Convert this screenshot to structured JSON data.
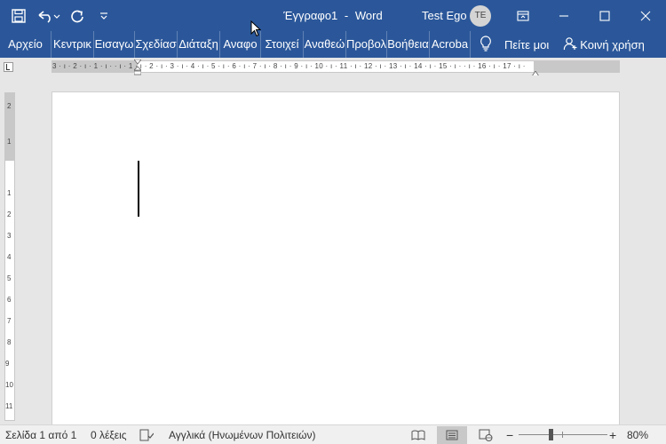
{
  "colors": {
    "accent": "#2b579a",
    "statusbar": "#f0f0f0",
    "canvas": "#e6e6e6"
  },
  "qat": {
    "save_icon": "save-icon",
    "undo_icon": "undo-icon",
    "redo_icon": "redo-icon",
    "customize_icon": "customize-qat-icon"
  },
  "window": {
    "doc_title": "Έγγραφο1",
    "separator": "-",
    "app_name": "Word",
    "user_name": "Test Ego",
    "user_initials": "TE"
  },
  "tabs": [
    {
      "label": "Αρχείο"
    },
    {
      "label": "Κεντρικ"
    },
    {
      "label": "Εισαγω"
    },
    {
      "label": "Σχεδίασ"
    },
    {
      "label": "Διάταξη"
    },
    {
      "label": "Αναφο"
    },
    {
      "label": "Στοιχεί"
    },
    {
      "label": "Αναθεώ"
    },
    {
      "label": "Προβολ"
    },
    {
      "label": "Βοήθεια"
    },
    {
      "label": "Acroba"
    }
  ],
  "tell_me": {
    "label": "Πείτε μοι",
    "icon": "lightbulb-icon"
  },
  "share": {
    "label": "Κοινή χρήση",
    "icon": "add-person-icon"
  },
  "ruler": {
    "horizontal_labels": "3 · ı · 2 · ı · 1 · ı ·    · ı · 1 · ı · 2 · ı · 3 · ı · 4 · ı · 5 · ı · 6 · ı · 7 · ı · 8 · ı · 9 · ı · 10 · ı · 11 · ı · 12 · ı · 13 · ı · 14 · ı · 15 · ı ·   · ı · 16 · ı · 17 · ı ·",
    "vertical_labels": [
      "2",
      "1",
      "1",
      "2",
      "3",
      "4",
      "5",
      "6",
      "7",
      "8",
      "9",
      "10",
      "11"
    ]
  },
  "status": {
    "page": "Σελίδα 1 από 1",
    "words": "0 λέξεις",
    "language": "Αγγλικά (Ηνωμένων Πολιτειών)",
    "zoom": "80%",
    "zoom_minus": "−",
    "zoom_plus": "+"
  }
}
